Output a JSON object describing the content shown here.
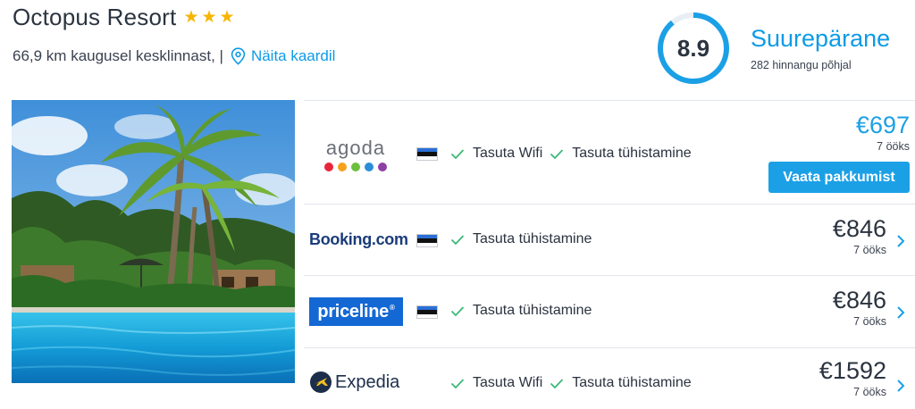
{
  "hotel": {
    "name": "Octopus Resort",
    "stars": 3,
    "distance_text": "66,9 km kaugusel kesklinnast, |",
    "map_link": "Näita kaardil"
  },
  "rating": {
    "score": "8.9",
    "label": "Suurepärane",
    "count_text": "282 hinnangu põhjal",
    "accent_color": "#0d9be6"
  },
  "offers": [
    {
      "provider": "agoda",
      "logo_text": "agoda",
      "features": [
        "Tasuta Wifi",
        "Tasuta tühistamine"
      ],
      "price": "€697",
      "nights": "7 ööks",
      "button_label": "Vaata pakkumist",
      "highlight": true
    },
    {
      "provider": "booking",
      "logo_text": "Booking.com",
      "features": [
        "Tasuta tühistamine"
      ],
      "price": "€846",
      "nights": "7 ööks"
    },
    {
      "provider": "priceline",
      "logo_text": "priceline",
      "features": [
        "Tasuta tühistamine"
      ],
      "price": "€846",
      "nights": "7 ööks"
    },
    {
      "provider": "expedia",
      "logo_text": "Expedia",
      "features": [
        "Tasuta Wifi",
        "Tasuta tühistamine"
      ],
      "price": "€1592",
      "nights": "7 ööks"
    }
  ],
  "colors": {
    "price_highlight": "#1ba0e6",
    "check_green": "#3cb878",
    "star_gold": "#f7b500"
  }
}
